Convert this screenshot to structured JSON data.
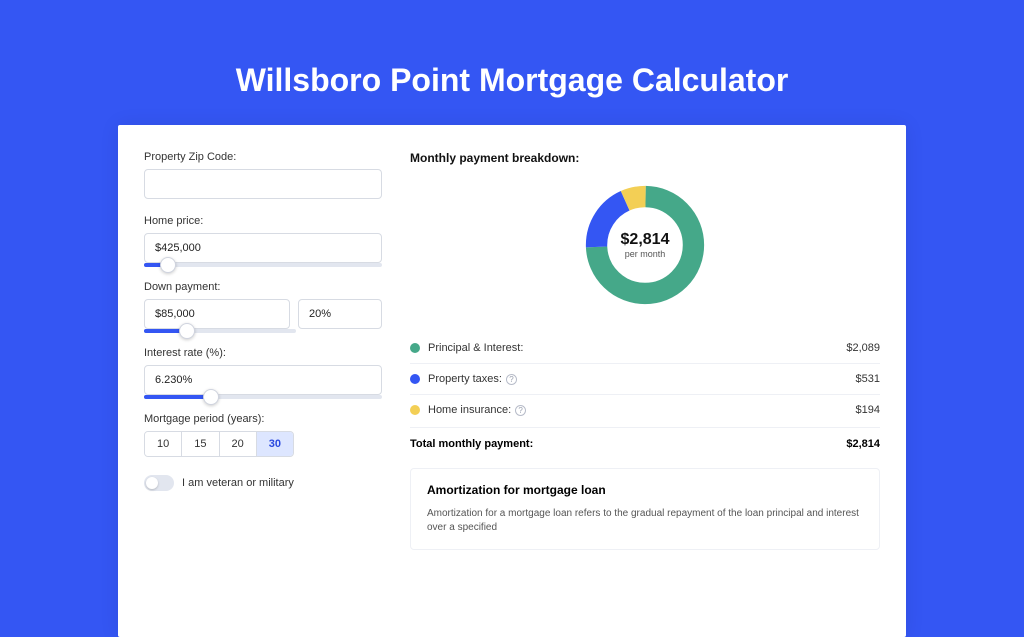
{
  "title": "Willsboro Point Mortgage Calculator",
  "form": {
    "zip": {
      "label": "Property Zip Code:",
      "value": ""
    },
    "home_price": {
      "label": "Home price:",
      "value": "$425,000",
      "slider_pct": 10
    },
    "down_payment": {
      "label": "Down payment:",
      "value": "$85,000",
      "pct_value": "20%",
      "slider_pct": 18
    },
    "interest": {
      "label": "Interest rate (%):",
      "value": "6.230%",
      "slider_pct": 28
    },
    "period": {
      "label": "Mortgage period (years):",
      "options": [
        "10",
        "15",
        "20",
        "30"
      ],
      "selected": "30"
    },
    "veteran": {
      "label": "I am veteran or military",
      "value": false
    }
  },
  "breakdown": {
    "title": "Monthly payment breakdown:",
    "center_amount": "$2,814",
    "center_sub": "per month",
    "items": [
      {
        "label": "Principal & Interest:",
        "value": "$2,089",
        "color": "#45a889",
        "info": false
      },
      {
        "label": "Property taxes:",
        "value": "$531",
        "color": "#3456f3",
        "info": true
      },
      {
        "label": "Home insurance:",
        "value": "$194",
        "color": "#f3cf55",
        "info": true
      }
    ],
    "total_label": "Total monthly payment:",
    "total_value": "$2,814"
  },
  "chart_data": {
    "type": "pie",
    "title": "Monthly payment breakdown",
    "series": [
      {
        "name": "Principal & Interest",
        "value": 2089,
        "color": "#45a889"
      },
      {
        "name": "Property taxes",
        "value": 531,
        "color": "#3456f3"
      },
      {
        "name": "Home insurance",
        "value": 194,
        "color": "#f3cf55"
      }
    ],
    "total": 2814,
    "center_label": "$2,814 per month"
  },
  "amortization": {
    "title": "Amortization for mortgage loan",
    "body": "Amortization for a mortgage loan refers to the gradual repayment of the loan principal and interest over a specified"
  }
}
